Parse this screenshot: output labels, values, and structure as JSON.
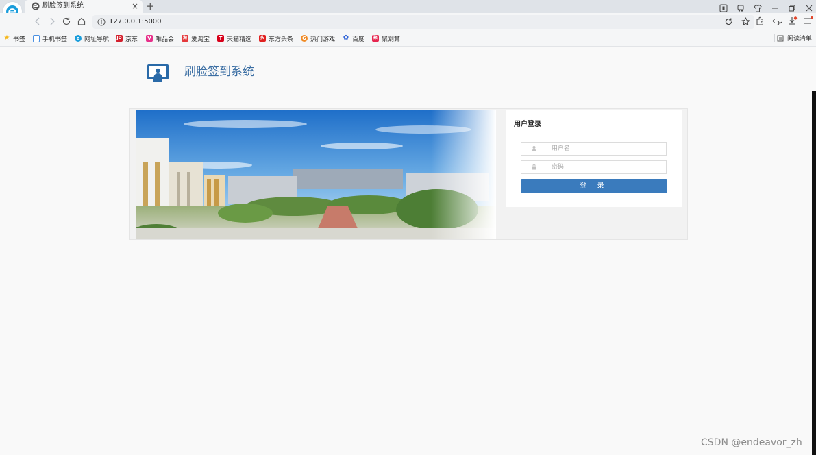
{
  "browser": {
    "tab_title": "刷脸签到系统",
    "new_tab": "+",
    "tab_close": "×",
    "address_url": "127.0.0.1:5000"
  },
  "bookmarks": [
    {
      "label": "书签",
      "icon": "star-icon",
      "color": "#f5b71a",
      "glyph": "★"
    },
    {
      "label": "手机书签",
      "icon": "phone-icon",
      "color": "#4a90e2",
      "glyph": ""
    },
    {
      "label": "网址导航",
      "icon": "browser-e-icon",
      "color": "#1a9ddb",
      "glyph": "e"
    },
    {
      "label": "京东",
      "icon": "jd-icon",
      "color": "#d3202d",
      "glyph": "JD"
    },
    {
      "label": "唯品会",
      "icon": "vip-icon",
      "color": "#e7308a",
      "glyph": "V"
    },
    {
      "label": "爱淘宝",
      "icon": "taobao-icon",
      "color": "#e4393c",
      "glyph": "淘"
    },
    {
      "label": "天猫精选",
      "icon": "tmall-icon",
      "color": "#d8001a",
      "glyph": "T"
    },
    {
      "label": "东方头条",
      "icon": "toutiao-icon",
      "color": "#e02020",
      "glyph": "头"
    },
    {
      "label": "热门游戏",
      "icon": "game-icon",
      "color": "#f08a24",
      "glyph": "G"
    },
    {
      "label": "百度",
      "icon": "baidu-paw-icon",
      "color": "#2f63d6",
      "glyph": "✿"
    },
    {
      "label": "聚划算",
      "icon": "juhuasuan-icon",
      "color": "#e6264f",
      "glyph": "聚"
    }
  ],
  "reading_list": "阅读清单",
  "site": {
    "title": "刷脸签到系统"
  },
  "login": {
    "title": "用户登录",
    "username_placeholder": "用户名",
    "password_placeholder": "密码",
    "button": "登 录"
  },
  "watermark": "CSDN @endeavor_zh",
  "colors": {
    "accent": "#3a7bbd",
    "title_blue": "#3b6ea3"
  }
}
